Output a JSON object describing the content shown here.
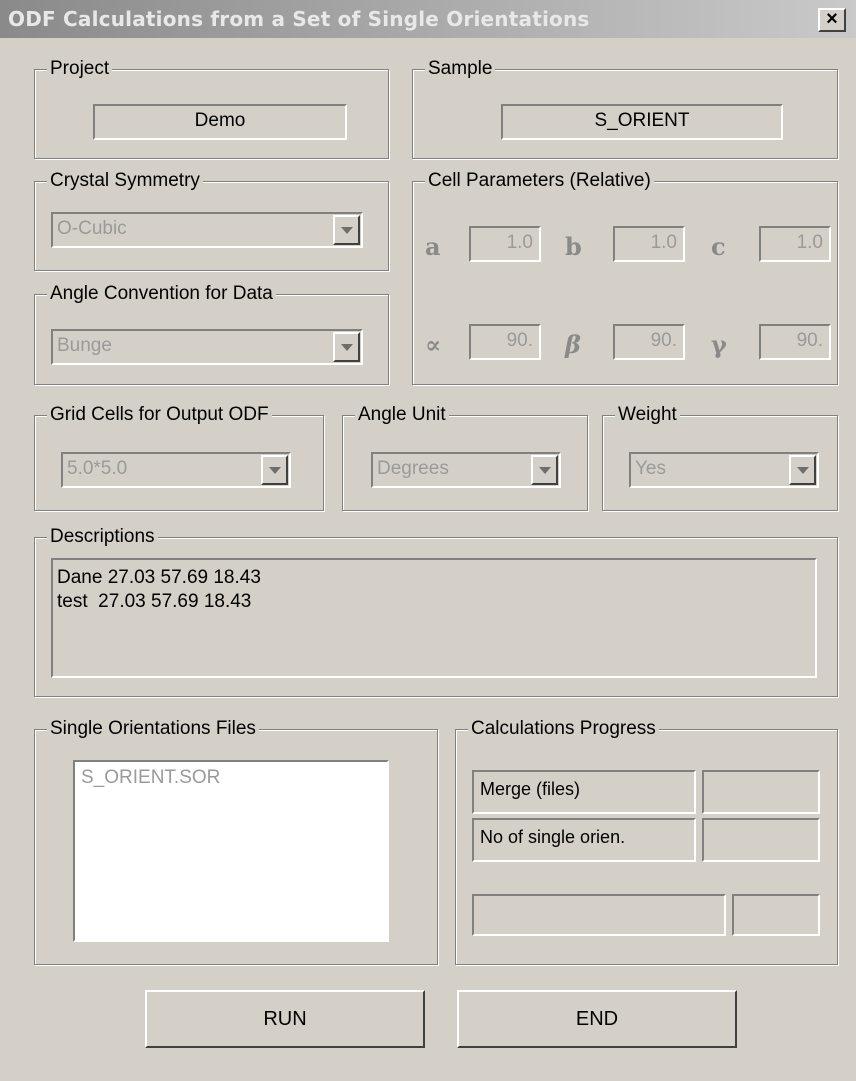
{
  "window": {
    "title": "ODF Calculations from a Set of Single Orientations",
    "close_label": "×"
  },
  "project": {
    "legend": "Project",
    "value": "Demo"
  },
  "sample": {
    "legend": "Sample",
    "value": "S_ORIENT"
  },
  "crystal_symmetry": {
    "legend": "Crystal Symmetry",
    "value": "O-Cubic"
  },
  "angle_convention": {
    "legend": "Angle Convention for Data",
    "value": "Bunge"
  },
  "cell_parameters": {
    "legend": "Cell Parameters (Relative)",
    "a": {
      "symbol": "a",
      "value": "1.0"
    },
    "b": {
      "symbol": "b",
      "value": "1.0"
    },
    "c": {
      "symbol": "c",
      "value": "1.0"
    },
    "alpha": {
      "symbol": "∝",
      "value": "90."
    },
    "beta": {
      "symbol": "β",
      "value": "90."
    },
    "gamma": {
      "symbol": "γ",
      "value": "90."
    }
  },
  "grid_cells": {
    "legend": "Grid Cells for Output ODF",
    "value": "5.0*5.0"
  },
  "angle_unit": {
    "legend": "Angle Unit",
    "value": "Degrees"
  },
  "weight": {
    "legend": "Weight",
    "value": "Yes"
  },
  "descriptions": {
    "legend": "Descriptions",
    "line1": "Dane 27.03 57.69 18.43",
    "line2": "test  27.03 57.69 18.43"
  },
  "files": {
    "legend": "Single Orientations Files",
    "items": [
      "S_ORIENT.SOR"
    ]
  },
  "progress": {
    "legend": "Calculations Progress",
    "merge_label": "Merge (files)",
    "count_label": "No of single orien."
  },
  "buttons": {
    "run": "RUN",
    "end": "END"
  },
  "colors": {
    "face": "#d4d0c8",
    "shadow": "#808080",
    "disabled_text": "#9a9a9a"
  },
  "icons": {
    "close": "close-icon",
    "dropdown": "chevron-down-icon"
  }
}
